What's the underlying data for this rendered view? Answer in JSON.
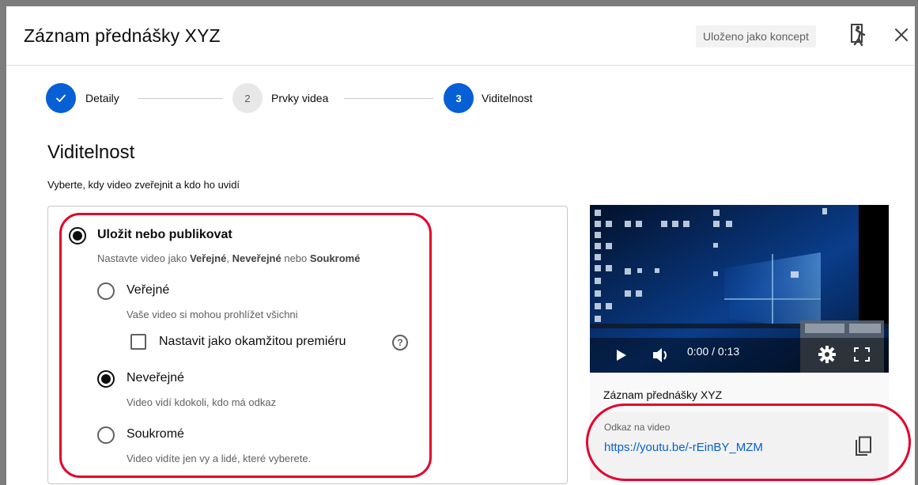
{
  "header": {
    "title": "Záznam přednášky XYZ",
    "draft_badge": "Uloženo jako koncept"
  },
  "stepper": {
    "steps": [
      {
        "number": "✓",
        "label": "Detaily",
        "state": "done"
      },
      {
        "number": "2",
        "label": "Prvky videa",
        "state": "todo"
      },
      {
        "number": "3",
        "label": "Viditelnost",
        "state": "current"
      }
    ]
  },
  "visibility": {
    "title": "Viditelnost",
    "subtitle": "Vyberte, kdy video zveřejnit a kdo ho uvidí"
  },
  "options": {
    "save_publish": {
      "label": "Uložit nebo publikovat",
      "desc_prefix": "Nastavte video jako ",
      "desc_public": "Veřejné",
      "desc_sep": ", ",
      "desc_unlisted": "Neveřejné",
      "desc_or": " nebo ",
      "desc_private": "Soukromé",
      "checked": true
    },
    "public": {
      "label": "Veřejné",
      "desc": "Vaše video si mohou prohlížet všichni",
      "checked": false
    },
    "premiere": {
      "label": "Nastavit jako okamžitou premiéru",
      "help": "?",
      "checked": false
    },
    "unlisted": {
      "label": "Neveřejné",
      "desc": "Video vidí kdokoli, kdo má odkaz",
      "checked": true
    },
    "private": {
      "label": "Soukromé",
      "desc": "Video vidíte jen vy a lidé, které vyberete.",
      "checked": false
    }
  },
  "video": {
    "time": "0:00 / 0:13",
    "title": "Záznam přednášky XYZ",
    "link_caption": "Odkaz na video",
    "link_url": "https://youtu.be/-rEinBY_MZM"
  },
  "colors": {
    "accent": "#065fd4",
    "highlight": "#e4002b"
  },
  "icons": [
    "feedback-icon",
    "close-icon",
    "check-icon",
    "help-icon",
    "play-icon",
    "volume-icon",
    "settings-icon",
    "fullscreen-icon",
    "copy-icon"
  ]
}
